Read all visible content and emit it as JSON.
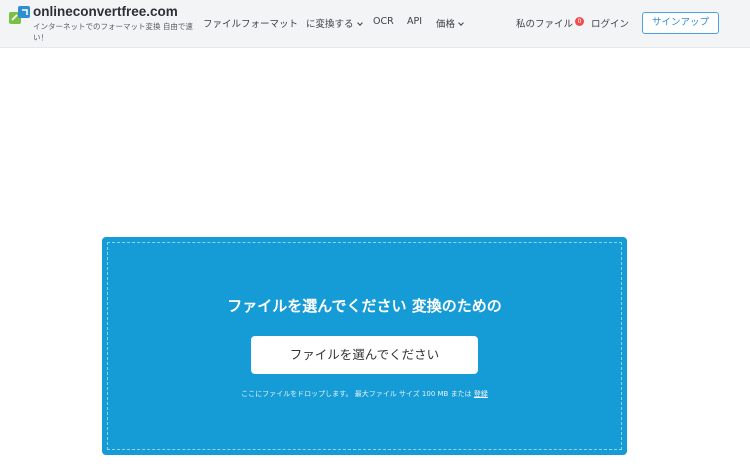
{
  "brand": {
    "name": "onlineconvertfree.com",
    "tagline": "インターネットでのフォーマット変換 自由で速い！",
    "colors": {
      "green": "#7bc043",
      "blue": "#2f8fd4"
    }
  },
  "nav": {
    "formats": "ファイルフォーマット",
    "convert": "に変換する",
    "ocr": "OCR",
    "api": "API",
    "pricing": "価格",
    "my_files": "私のファイル",
    "my_files_count": "0",
    "login": "ログイン",
    "signup": "サインアップ"
  },
  "upload": {
    "title": "ファイルを選んでください 変換のための",
    "choose_button": "ファイルを選んでください",
    "hint_text": "ここにファイルをドロップします。 最大ファイル サイズ 100 MB または",
    "hint_link": "登録",
    "panel_color": "#159bd6"
  }
}
